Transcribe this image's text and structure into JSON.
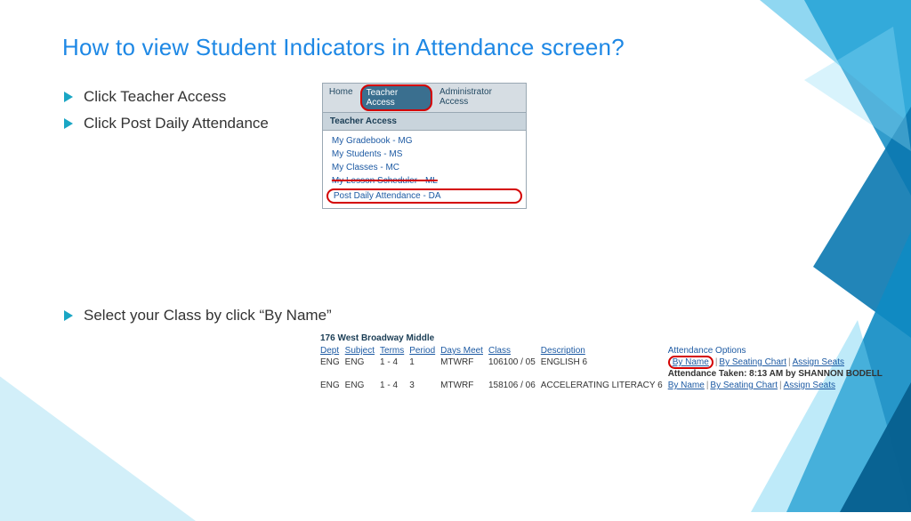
{
  "title": "How to view Student Indicators in Attendance screen?",
  "bullets": {
    "b1": "Click Teacher Access",
    "b2": "Click Post Daily Attendance",
    "b3": "Select your Class by click “By Name”"
  },
  "shot1": {
    "tabs": {
      "home": "Home",
      "teacher": "Teacher Access",
      "admin": "Administrator Access"
    },
    "panel": "Teacher Access",
    "menu": {
      "m1": "My Gradebook - MG",
      "m2": "My Students - MS",
      "m3": "My Classes - MC",
      "m4": "My Lesson Scheduler - ML",
      "m5": "Post Daily Attendance - DA"
    }
  },
  "shot2": {
    "school": "176 West Broadway Middle",
    "headers": {
      "dept": "Dept",
      "subject": "Subject",
      "terms": "Terms",
      "period": "Period",
      "days": "Days Meet",
      "class": "Class",
      "desc": "Description",
      "opts": "Attendance Options"
    },
    "rows": [
      {
        "dept": "ENG",
        "subject": "ENG",
        "terms": "1 - 4",
        "period": "1",
        "days": "MTWRF",
        "class": "106100 / 05",
        "desc": "ENGLISH 6"
      },
      {
        "dept": "ENG",
        "subject": "ENG",
        "terms": "1 - 4",
        "period": "3",
        "days": "MTWRF",
        "class": "158106 / 06",
        "desc": "ACCELERATING LITERACY 6"
      }
    ],
    "opts": {
      "byname": "By Name",
      "byseat": "By Seating Chart",
      "assign": "Assign Seats"
    },
    "taken": "Attendance Taken:   8:13 AM by SHANNON BODELL"
  }
}
